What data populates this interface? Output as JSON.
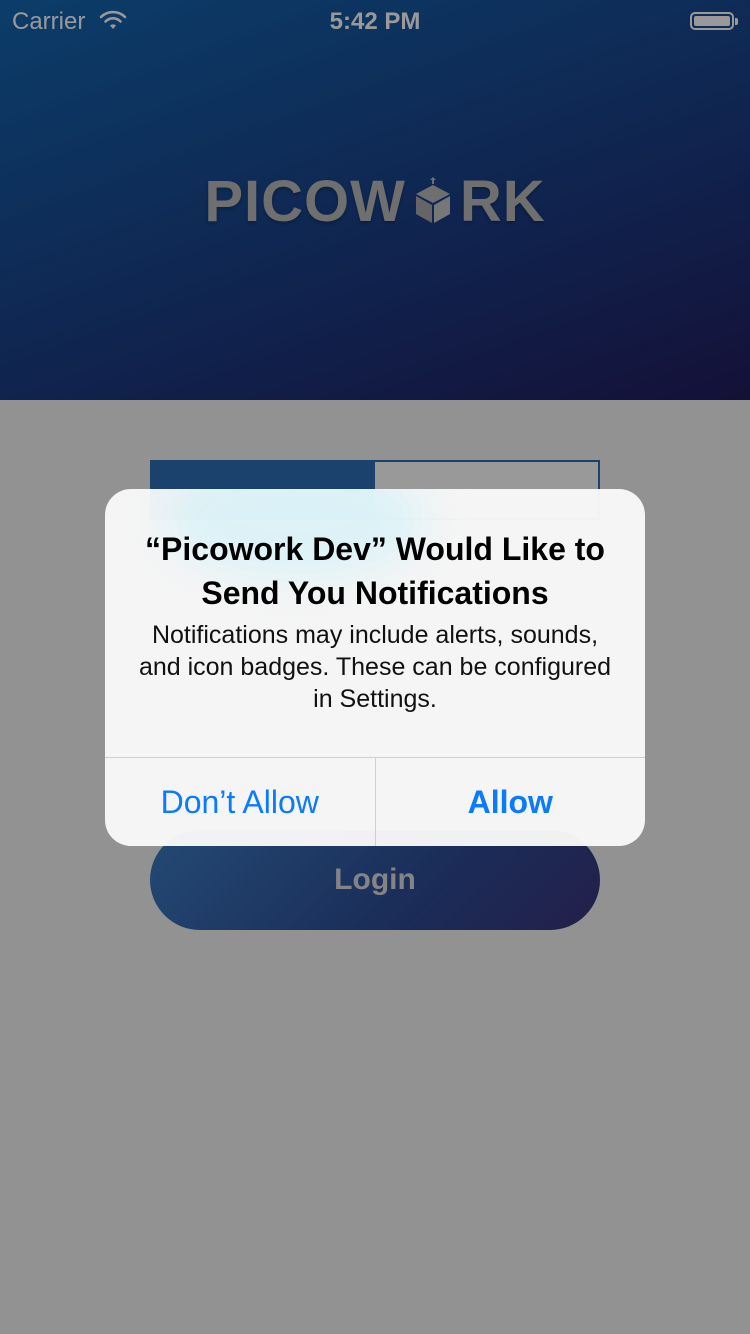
{
  "status_bar": {
    "carrier": "Carrier",
    "time": "5:42 PM",
    "wifi_icon": "wifi-icon",
    "battery_icon": "battery-icon"
  },
  "logo": {
    "text_left": "PICOW",
    "text_right": "RK",
    "icon": "box-icon"
  },
  "tabs": [
    {
      "label": ""
    },
    {
      "label": ""
    }
  ],
  "login": {
    "label": "Login"
  },
  "alert": {
    "title": "“Picowork Dev” Would Like to Send You Notifications",
    "message": "Notifications may include alerts, sounds, and icon badges. These can be configured in Settings.",
    "dont_allow": "Don’t Allow",
    "allow": "Allow"
  },
  "colors": {
    "header_gradient_start": "#1466b0",
    "header_gradient_end": "#221c5e",
    "alert_button": "#0a7aff",
    "overlay": "rgba(0,0,0,0.4)"
  }
}
